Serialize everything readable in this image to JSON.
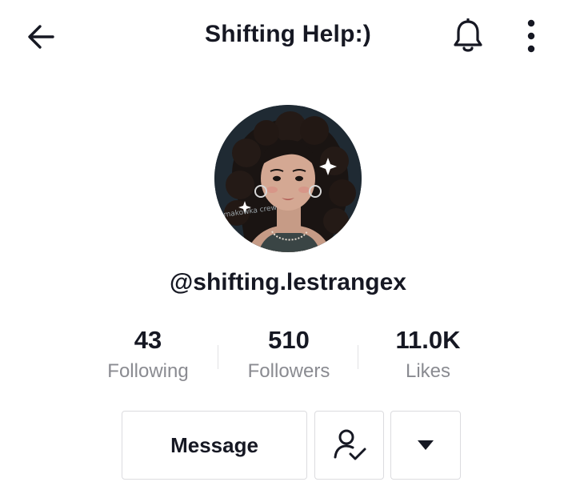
{
  "header": {
    "title": "Shifting Help:)",
    "back_icon": "arrow-left-icon",
    "notification_icon": "bell-icon",
    "more_icon": "vertical-dots-icon"
  },
  "profile": {
    "avatar_watermark": "makowka crew",
    "username": "@shifting.lestrangex"
  },
  "stats": [
    {
      "value": "43",
      "label": "Following"
    },
    {
      "value": "510",
      "label": "Followers"
    },
    {
      "value": "11.0K",
      "label": "Likes"
    }
  ],
  "actions": {
    "message_label": "Message",
    "following_icon": "user-check-icon",
    "dropdown_icon": "caret-down-icon"
  },
  "colors": {
    "text_primary": "#161823",
    "text_secondary": "#8a8b91",
    "border": "#dcdcdf"
  }
}
